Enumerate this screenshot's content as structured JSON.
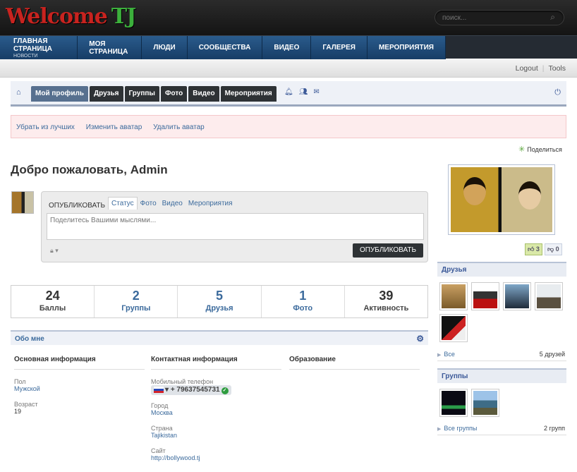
{
  "brand": {
    "logo_main": "Welcome",
    "logo_accent": "TJ"
  },
  "search": {
    "placeholder": "поиск..."
  },
  "nav": {
    "items": [
      {
        "label": "Главная страница",
        "sub": "Новости"
      },
      {
        "label": "Моя страница"
      },
      {
        "label": "Люди"
      },
      {
        "label": "Сообщества"
      },
      {
        "label": "Видео"
      },
      {
        "label": "Галерея"
      },
      {
        "label": "Мероприятия"
      }
    ]
  },
  "toplinks": {
    "logout": "Logout",
    "tools": "Tools"
  },
  "subnav": {
    "tabs": [
      "Мой профиль",
      "Друзья",
      "Группы",
      "Фото",
      "Видео",
      "Мероприятия"
    ]
  },
  "alert": {
    "links": [
      "Убрать из лучших",
      "Изменить аватар",
      "Удалить аватар"
    ]
  },
  "share": {
    "label": "Поделиться"
  },
  "welcome": "Добро пожаловать, Admin",
  "composer": {
    "label": "Опубликовать",
    "tabs": [
      "Статус",
      "Фото",
      "Видео",
      "Мероприятия"
    ],
    "placeholder": "Поделитесь Вашими мыслями...",
    "button": "Опубликовать"
  },
  "stats": [
    {
      "value": "24",
      "label": "Баллы"
    },
    {
      "value": "2",
      "label": "Группы"
    },
    {
      "value": "5",
      "label": "Друзья"
    },
    {
      "value": "1",
      "label": "Фото"
    },
    {
      "value": "39",
      "label": "Активность"
    }
  ],
  "about": {
    "title": "Обо мне",
    "basic": {
      "title": "Основная информация",
      "gender_label": "Пол",
      "gender": "Мужской",
      "age_label": "Возраст",
      "age": "19"
    },
    "contact": {
      "title": "Контактная информация",
      "phone_label": "Мобильный телефон",
      "phone": "+ 79637545731",
      "city_label": "Город",
      "city": "Москва",
      "country_label": "Страна",
      "country": "Tajikistan",
      "site_label": "Сайт",
      "site": "http://bollywood.tj"
    },
    "education": {
      "title": "Образование"
    }
  },
  "votes": {
    "up": "3",
    "down": "0"
  },
  "friends": {
    "title": "Друзья",
    "all": "Все",
    "count": "5 друзей"
  },
  "groups": {
    "title": "Группы",
    "all": "Все группы",
    "count": "2 групп"
  }
}
